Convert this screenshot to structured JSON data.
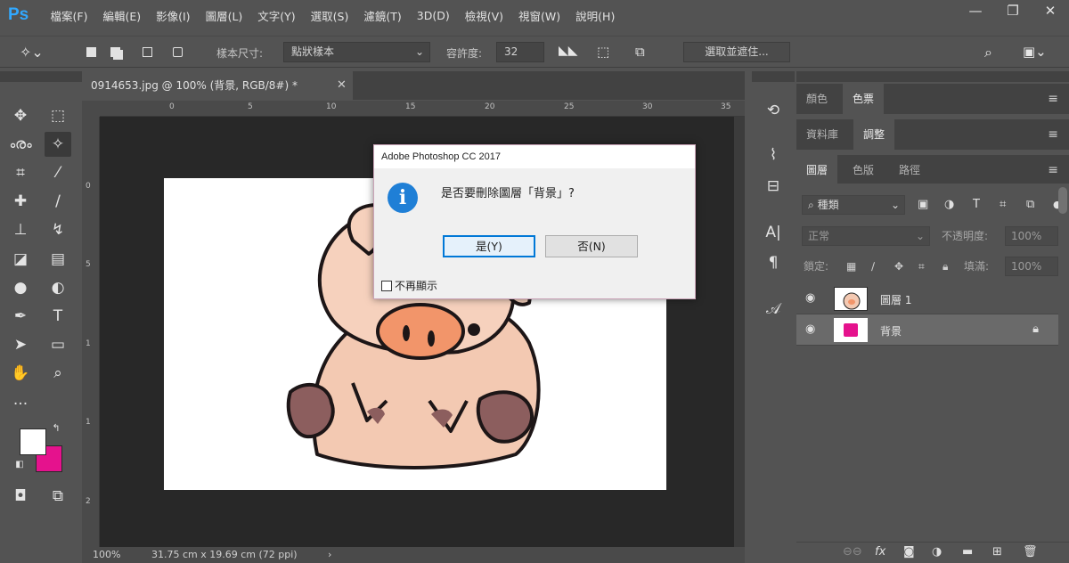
{
  "app": {
    "logo": "Ps"
  },
  "menu": [
    "檔案(F)",
    "編輯(E)",
    "影像(I)",
    "圖層(L)",
    "文字(Y)",
    "選取(S)",
    "濾鏡(T)",
    "3D(D)",
    "檢視(V)",
    "視窗(W)",
    "說明(H)"
  ],
  "options": {
    "sample_size_label": "樣本尺寸:",
    "sample_size_value": "點狀樣本",
    "tolerance_label": "容許度:",
    "tolerance_value": "32",
    "select_mask_button": "選取並遮住..."
  },
  "document": {
    "tab_title": "0914653.jpg @ 100% (背景, RGB/8#) *",
    "ruler_top": [
      "0",
      "5",
      "10",
      "15",
      "20",
      "25",
      "30",
      "35"
    ],
    "ruler_left": [
      "0",
      "5",
      "1",
      "1",
      "2"
    ],
    "zoom": "100%",
    "dimensions": "31.75 cm x 19.69 cm (72 ppi)"
  },
  "dialog": {
    "title": "Adobe Photoshop CC 2017",
    "message": "是否要刪除圖層「背景」?",
    "yes_button": "是(Y)",
    "no_button": "否(N)",
    "dont_show_again": "不再顯示"
  },
  "panels": {
    "row1": {
      "tabs": [
        "顏色",
        "色票"
      ],
      "active": 1
    },
    "row2": {
      "tabs": [
        "資料庫",
        "調整"
      ],
      "active": 1
    },
    "row3": {
      "tabs": [
        "圖層",
        "色版",
        "路徑"
      ],
      "active": 0
    },
    "filter_kind": "種類",
    "blend_mode": "正常",
    "opacity_label": "不透明度:",
    "opacity_value": "100%",
    "lock_label": "鎖定:",
    "fill_label": "填滿:",
    "fill_value": "100%",
    "layers": [
      {
        "name": "圖層 1",
        "selected": false,
        "locked": false
      },
      {
        "name": "背景",
        "selected": true,
        "locked": true
      }
    ]
  },
  "colors": {
    "foreground": "#ffffff",
    "background": "#e5128d",
    "app_bg": "#535353"
  }
}
